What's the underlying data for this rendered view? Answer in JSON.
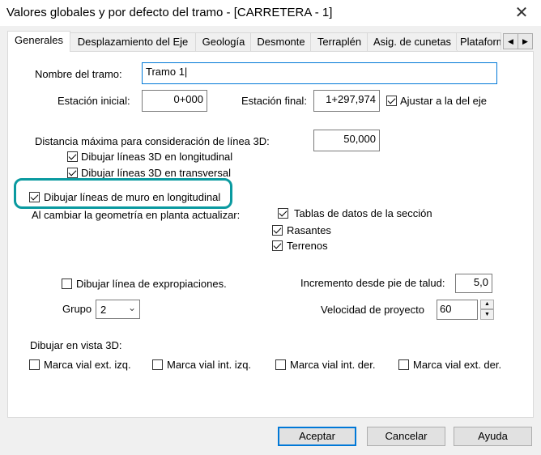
{
  "window": {
    "title": "Valores globales y por defecto del tramo  - [CARRETERA - 1]"
  },
  "tabs": [
    {
      "label": "Generales",
      "active": true
    },
    {
      "label": "Desplazamiento del Eje"
    },
    {
      "label": "Geología"
    },
    {
      "label": "Desmonte"
    },
    {
      "label": "Terraplén"
    },
    {
      "label": "Asig. de cunetas"
    },
    {
      "label": "Plataforma"
    }
  ],
  "form": {
    "nombre_label": "Nombre del tramo:",
    "nombre_value": "Tramo 1",
    "estacion_inicial_label": "Estación inicial:",
    "estacion_inicial_value": "0+000",
    "estacion_final_label": "Estación final:",
    "estacion_final_value": "1+297,974",
    "ajustar_label": "Ajustar a la del eje",
    "distancia_label": "Distancia máxima para consideración de línea 3D:",
    "distancia_value": "50,000",
    "lineas_long_label": "Dibujar líneas 3D en longitudinal",
    "lineas_trans_label": "Dibujar líneas 3D en transversal",
    "muro_label": "Dibujar líneas de muro en longitudinal",
    "al_cambiar_label": "Al cambiar la geometría en planta actualizar:",
    "tablas_label": "Tablas de datos de la sección",
    "rasantes_label": "Rasantes",
    "terrenos_label": "Terrenos",
    "expropiaciones_label": "Dibujar línea de expropiaciones.",
    "incremento_label": "Incremento desde pie de talud:",
    "incremento_value": "5,0",
    "grupo_label": "Grupo",
    "grupo_value": "2",
    "velocidad_label": "Velocidad de proyecto",
    "velocidad_value": "60",
    "vista3d_label": "Dibujar en vista 3D:",
    "marca_ext_izq": "Marca vial ext. izq.",
    "marca_int_izq": "Marca vial int. izq.",
    "marca_int_der": "Marca vial int. der.",
    "marca_ext_der": "Marca vial ext. der."
  },
  "checks": {
    "ajustar": true,
    "lineas_long": true,
    "lineas_trans": true,
    "muro": true,
    "tablas": true,
    "rasantes": true,
    "terrenos": true,
    "expropiaciones": false,
    "marca_ext_izq": false,
    "marca_int_izq": false,
    "marca_int_der": false,
    "marca_ext_der": false
  },
  "buttons": {
    "aceptar": "Aceptar",
    "cancelar": "Cancelar",
    "ayuda": "Ayuda"
  },
  "colors": {
    "highlight": "#0a9aa0",
    "focus": "#0078d7"
  },
  "icons": {
    "close": "close-icon",
    "tab_left": "chevron-left-icon",
    "tab_right": "chevron-right-icon",
    "dropdown": "chevron-down-icon"
  }
}
